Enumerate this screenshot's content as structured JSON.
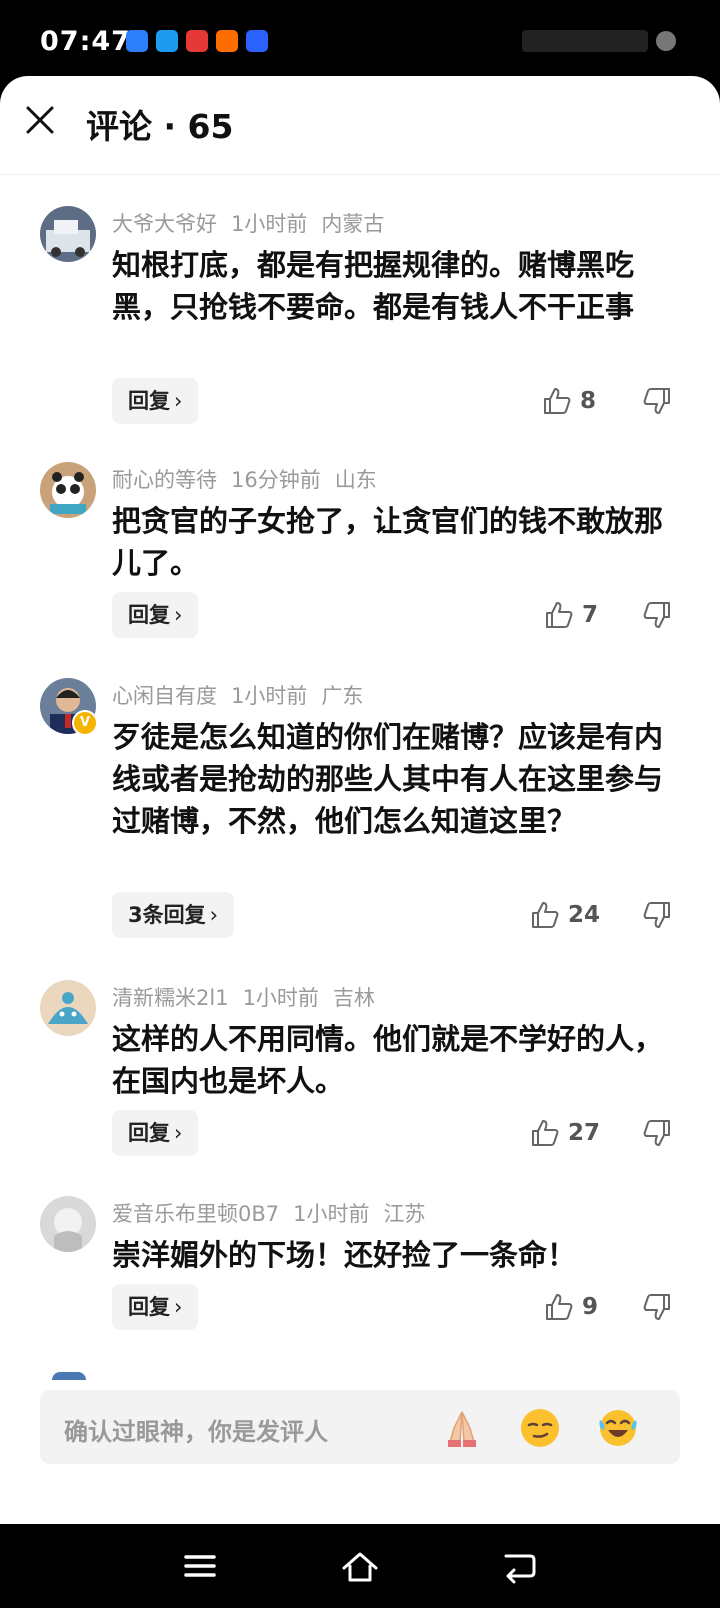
{
  "status_bar": {
    "time": "07:47",
    "app_icon_colors": [
      "#2d7ff9",
      "#1d9bf0",
      "#e53935",
      "#ff6d00",
      "#2962ff"
    ]
  },
  "header": {
    "title": "评论 · 65"
  },
  "comments": [
    {
      "username": "大爷大爷好",
      "time": "1小时前",
      "location": "内蒙古",
      "text": "知根打底，都是有把握规律的。赌博黑吃黑，只抢钱不要命。都是有钱人不干正事",
      "reply_label": "回复",
      "likes": "8"
    },
    {
      "username": "耐心的等待",
      "time": "16分钟前",
      "location": "山东",
      "text": "把贪官的子女抢了，让贪官们的钱不敢放那儿了。",
      "reply_label": "回复",
      "likes": "7"
    },
    {
      "username": "心闲自有度",
      "time": "1小时前",
      "location": "广东",
      "text": "歹徒是怎么知道的你们在赌博？应该是有内线或者是抢劫的那些人其中有人在这里参与过赌博，不然，他们怎么知道这里？",
      "reply_label": "3条回复",
      "likes": "24",
      "badge": "V"
    },
    {
      "username": "清新糯米2l1",
      "time": "1小时前",
      "location": "吉林",
      "text": "这样的人不用同情。他们就是不学好的人，在国内也是坏人。",
      "reply_label": "回复",
      "likes": "27"
    },
    {
      "username": "爱音乐布里顿0B7",
      "time": "1小时前",
      "location": "江苏",
      "text": "崇洋媚外的下场！还好捡了一条命！",
      "reply_label": "回复",
      "likes": "9"
    }
  ],
  "input": {
    "placeholder": "确认过眼神，你是发评人"
  },
  "icons": {
    "close": "close-icon",
    "like": "thumbs-up-icon",
    "dislike": "thumbs-down-icon",
    "emoji_1": "pray-emoji-icon",
    "emoji_2": "smirk-emoji-icon",
    "emoji_3": "laugh-cry-emoji-icon",
    "nav_menu": "menu-icon",
    "nav_home": "home-icon",
    "nav_back": "back-icon"
  }
}
